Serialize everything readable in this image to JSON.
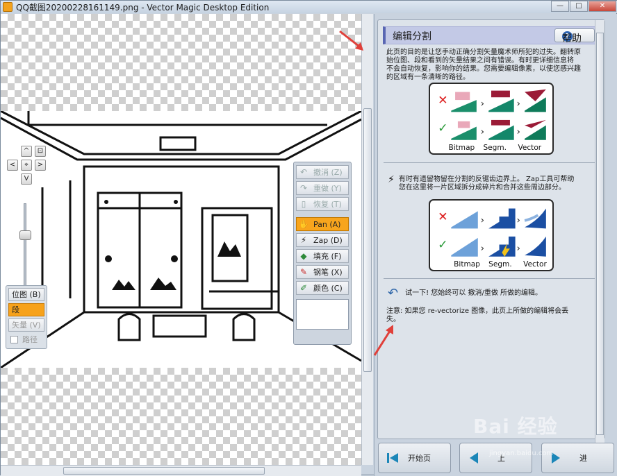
{
  "window": {
    "title": "QQ截图20200228161149.png - Vector Magic Desktop Edition",
    "controls": {
      "minimize": "—",
      "maximize": "□",
      "close": "✕"
    }
  },
  "nav": {
    "up": "^",
    "down": "V",
    "left": "<",
    "right": ">",
    "center": "⌖",
    "fit": "⊡"
  },
  "modes": {
    "items": [
      {
        "label": "位图 (B)",
        "state": "normal"
      },
      {
        "label": "段",
        "state": "active"
      },
      {
        "label": "矢量 (V)",
        "state": "disabled"
      }
    ],
    "path_label": "路径"
  },
  "tools": {
    "undo": "撤消 (Z)",
    "redo": "重做 (Y)",
    "restore": "恢复 (T)",
    "pan": "Pan (A)",
    "zap": "Zap (D)",
    "fill": "填充 (F)",
    "pencil": "钢笔 (X)",
    "color": "颜色 (C)"
  },
  "help": {
    "title": "编辑分割",
    "help_button": "帮助",
    "intro": [
      "此页的目的是让您手动正确分割矢量魔术师所犯的过失。翻转原",
      "始位图、段和看到的矢量结果之间有错误。有时更详细信息将",
      "不会自动恢复，影响你的结果。您需要编辑像素，以使您感兴趣",
      "的区域有一条清晰的路径。"
    ],
    "diagram1_labels": [
      "Bitmap",
      "Segm.",
      "Vector"
    ],
    "zap_text": [
      "有时有遗留物留在分割的反锯齿边界上。 Zap工具可帮助",
      "您在这里将一片区域拆分成碎片和合并这些周边部分。"
    ],
    "diagram2_labels": [
      "Bitmap",
      "Segm.",
      "Vector"
    ],
    "try_text": "试一下! 您始终可以 撤消/重做 所做的编辑。",
    "note_text": [
      "注意: 如果您 re-vectorize 图像，此页上所做的编辑将会丢",
      "失。"
    ]
  },
  "footer": {
    "start": "开始页",
    "prev": "上",
    "next": "进"
  },
  "watermark": {
    "text": "Bai 经验",
    "sub": "jingyan.baidu.com"
  },
  "colors": {
    "accent_orange": "#f7a21b",
    "title_bar_blue": "#5966b3",
    "arrow_red": "#e0403a"
  }
}
